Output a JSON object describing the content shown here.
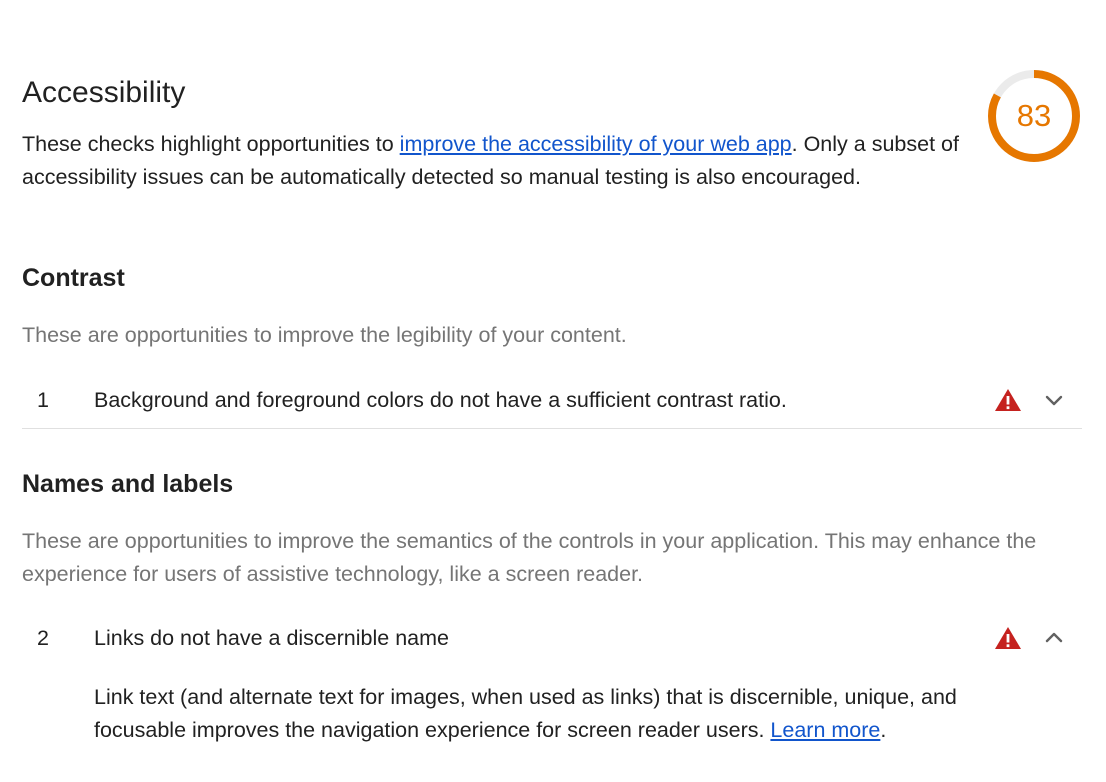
{
  "header": {
    "title": "Accessibility",
    "intro_before": "These checks highlight opportunities to ",
    "intro_link": "improve the accessibility of your web app",
    "intro_after": ". Only a subset of accessibility issues can be automatically detected so manual testing is also encouraged."
  },
  "score": {
    "value": "83",
    "fraction": 0.83,
    "color": "#e67700",
    "track_color": "#ebebeb"
  },
  "groups": [
    {
      "title": "Contrast",
      "description": "These are opportunities to improve the legibility of your content.",
      "audits": [
        {
          "number": "1",
          "title": "Background and foreground colors do not have a sufficient contrast ratio.",
          "status_icon": "warning-triangle-icon",
          "toggle_icon": "chevron-down-icon",
          "expanded": false
        }
      ]
    },
    {
      "title": "Names and labels",
      "description": "These are opportunities to improve the semantics of the controls in your application. This may enhance the experience for users of assistive technology, like a screen reader.",
      "audits": [
        {
          "number": "2",
          "title": "Links do not have a discernible name",
          "status_icon": "warning-triangle-icon",
          "toggle_icon": "chevron-up-icon",
          "expanded": true,
          "description_before": "Link text (and alternate text for images, when used as links) that is discernible, unique, and focusable improves the navigation experience for screen reader users. ",
          "description_link": "Learn more",
          "description_after": "."
        }
      ]
    }
  ],
  "colors": {
    "fail": "#c5221f",
    "link": "#1155cc",
    "muted_text": "#757575",
    "text": "#212121"
  }
}
